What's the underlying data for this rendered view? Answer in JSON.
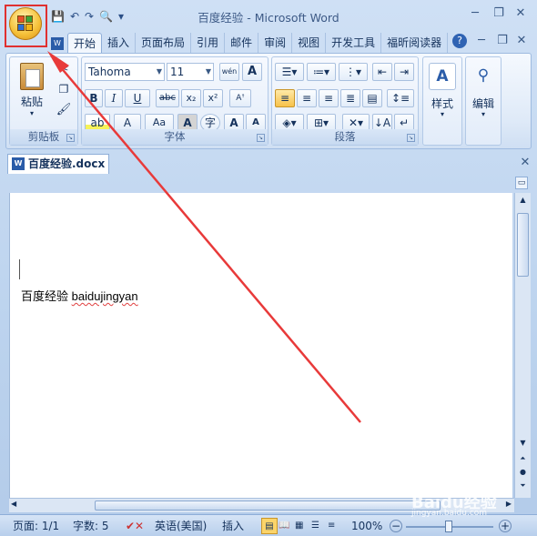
{
  "window": {
    "title": "百度经验 - Microsoft Word",
    "minimize": "─",
    "restore": "❐",
    "close": "✕"
  },
  "qat": {
    "save": "💾",
    "undo": "↶",
    "redo": "↷",
    "more": "▾"
  },
  "ribbon": {
    "tabs": [
      "开始",
      "插入",
      "页面布局",
      "引用",
      "邮件",
      "审阅",
      "视图",
      "开发工具",
      "福昕阅读器"
    ],
    "help": "?",
    "clipboard": {
      "paste": "粘贴",
      "label": "剪贴板"
    },
    "font": {
      "name": "Tahoma",
      "size": "11",
      "label": "字体",
      "bold": "B",
      "italic": "I",
      "underline": "U",
      "strike": "abc",
      "sub": "x₂",
      "sup": "x²",
      "grow": "A",
      "shrink": "A",
      "case": "Aa",
      "color": "A",
      "clear": "A",
      "phonetic": "wén",
      "border": "A"
    },
    "paragraph": {
      "label": "段落"
    },
    "styles": {
      "label": "样式"
    },
    "editing": {
      "label": "编辑"
    }
  },
  "document": {
    "tab_name": "百度经验.docx",
    "text_cn": "百度经验",
    "text_en": "baidujingyan"
  },
  "status": {
    "page": "页面: 1/1",
    "words": "字数: 5",
    "language": "英语(美国)",
    "mode": "插入",
    "zoom": "100%",
    "zoom_minus": "−",
    "zoom_plus": "+"
  },
  "watermark": {
    "brand": "Baidu经验",
    "url": "jingyan.baidu.com"
  }
}
